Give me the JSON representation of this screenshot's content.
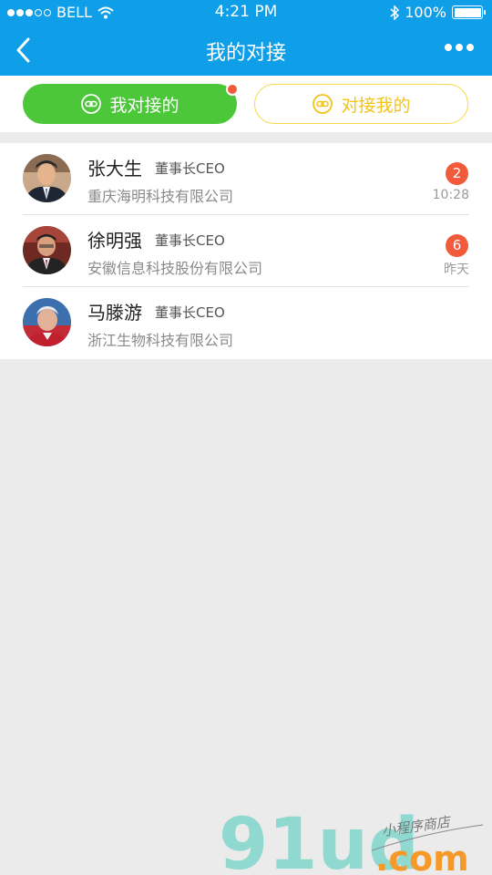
{
  "status": {
    "carrier": "BELL",
    "time": "4:21 PM",
    "battery": "100%",
    "battery_level": 1.0
  },
  "nav": {
    "title": "我的对接"
  },
  "tabs": [
    {
      "label": "我对接的",
      "active": true
    },
    {
      "label": "对接我的",
      "active": false
    }
  ],
  "contacts": [
    {
      "name": "张大生",
      "role": "董事长CEO",
      "company": "重庆海明科技有限公司",
      "badge": "2",
      "time": "10:28"
    },
    {
      "name": "徐明强",
      "role": "董事长CEO",
      "company": "安徽信息科技股份有限公司",
      "badge": "6",
      "time": "昨天"
    },
    {
      "name": "马滕游",
      "role": "董事长CEO",
      "company": "浙江生物科技有限公司",
      "badge": "",
      "time": ""
    }
  ],
  "watermark": {
    "logo": "91ud",
    "domain": ".com",
    "tagline": "小程序商店"
  },
  "colors": {
    "primary": "#0e9fe8",
    "green": "#4cc73a",
    "yellow": "#f3c21b",
    "badge": "#f15a3b",
    "background": "#ebebeb"
  }
}
